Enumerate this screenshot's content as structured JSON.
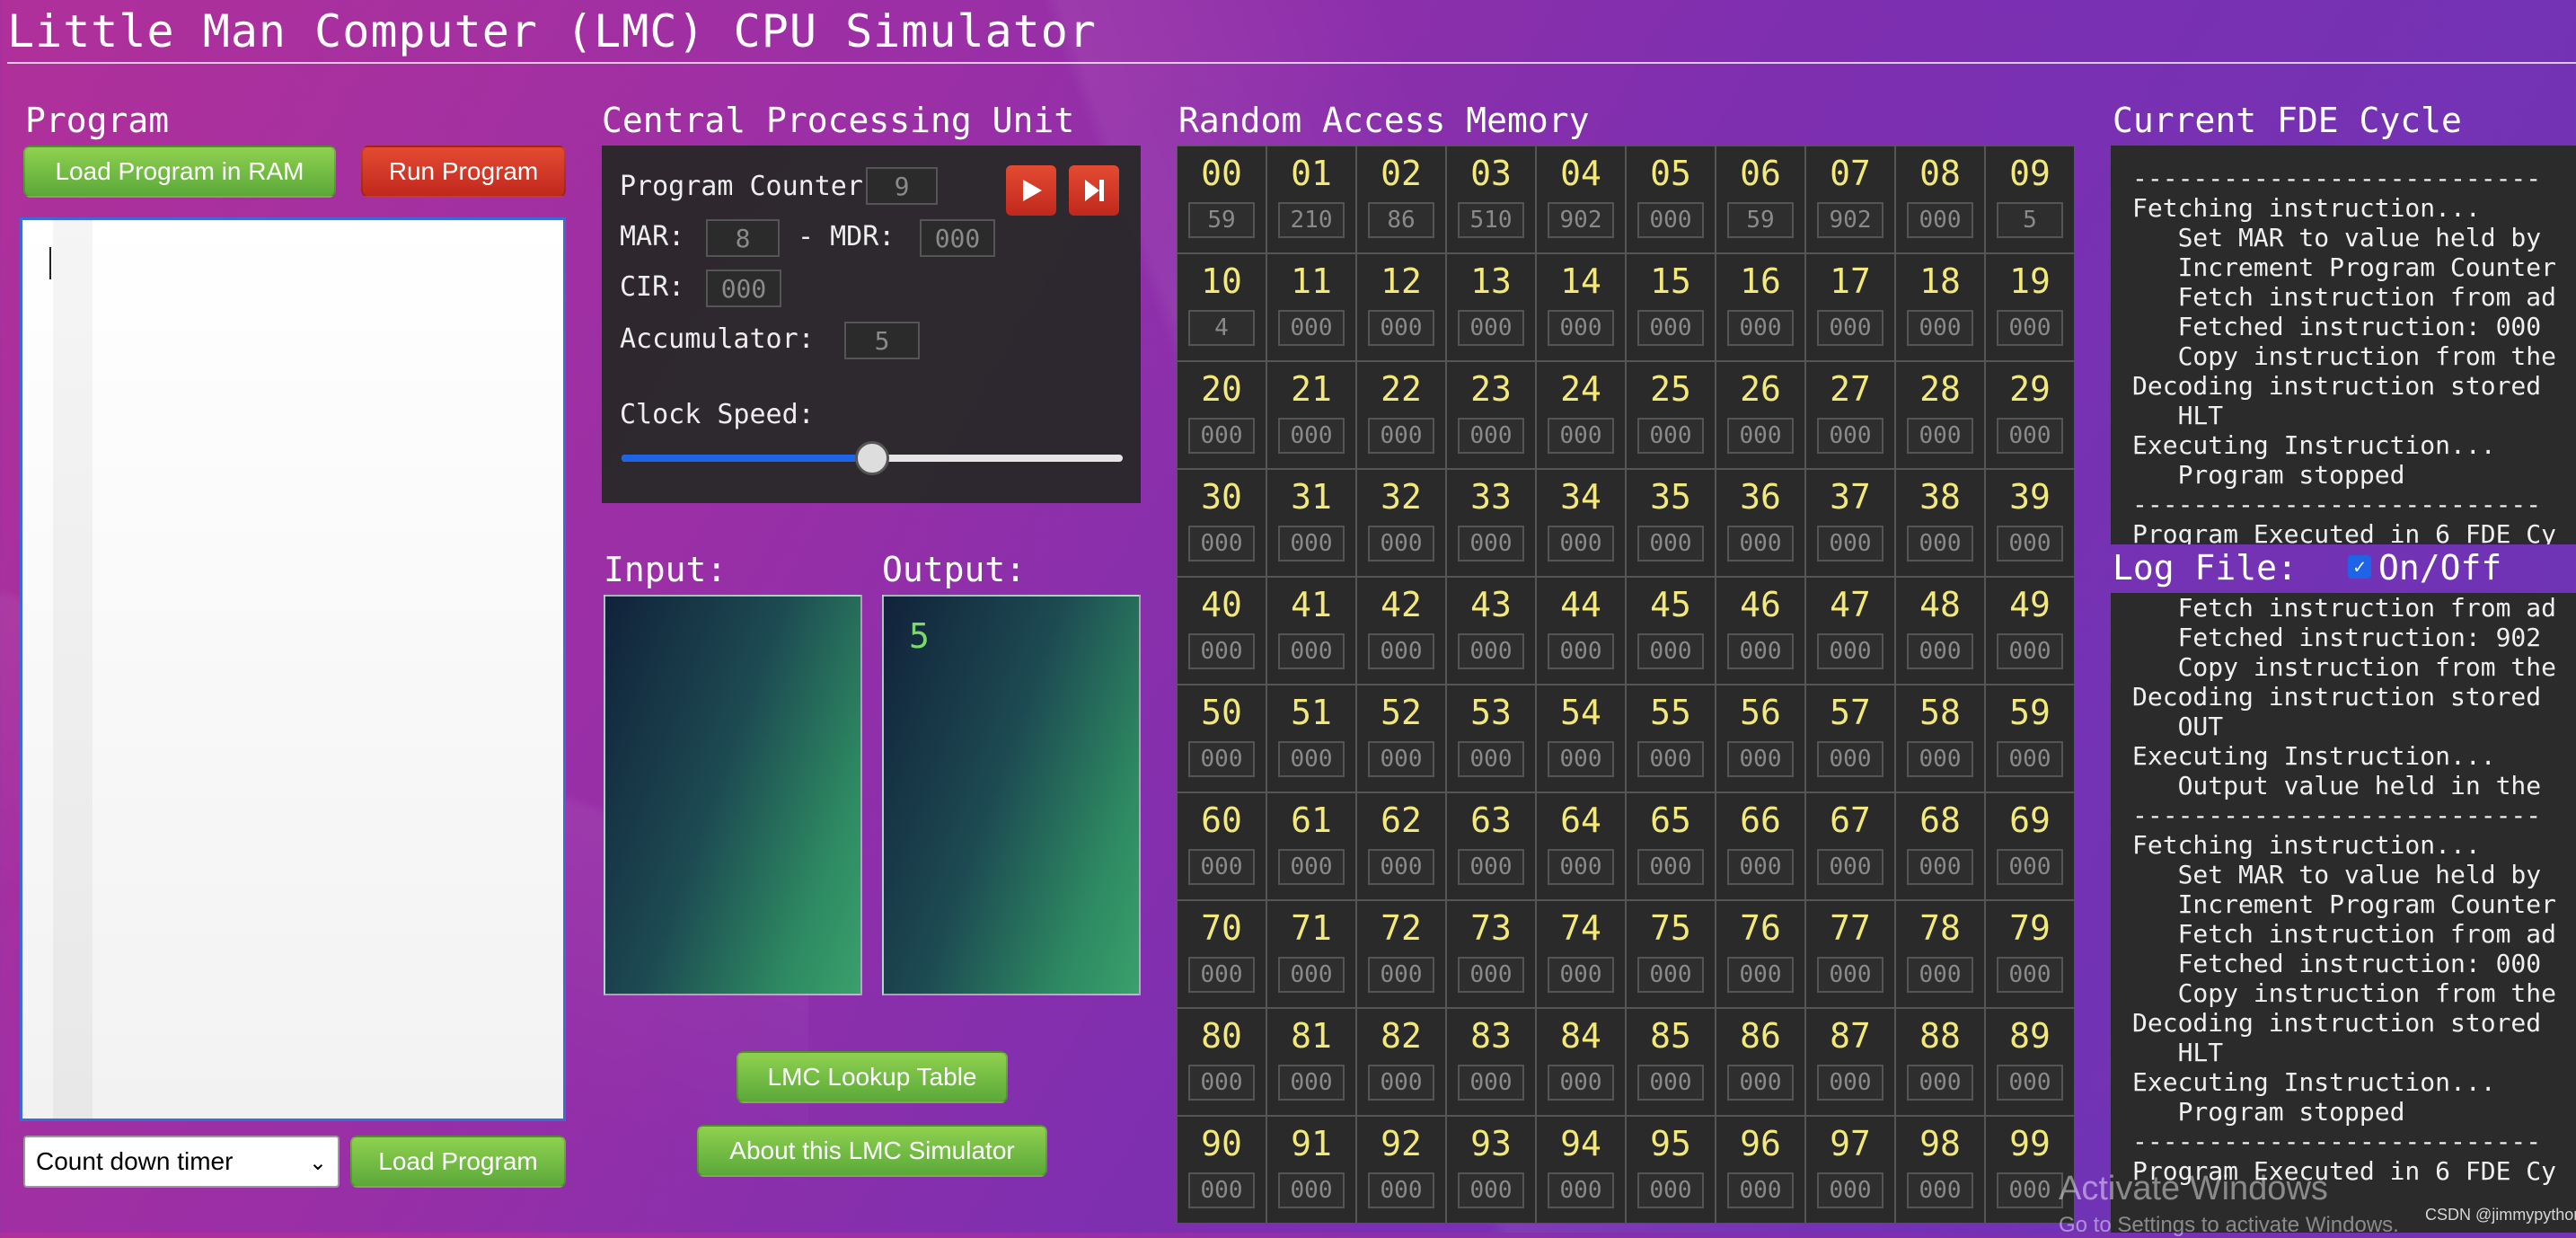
{
  "app_title": "Little Man Computer (LMC) CPU Simulator",
  "program": {
    "heading": "Program",
    "load_ram_label": "Load Program in RAM",
    "run_label": "Run Program",
    "timer_selected": "Count down timer",
    "load_program_label": "Load Program"
  },
  "cpu": {
    "heading": "Central Processing Unit",
    "pc_label": "Program Counter:",
    "pc_value": "9",
    "mar_label": "MAR:",
    "mar_value": "8",
    "mdr_label": "- MDR:",
    "mdr_value": "000",
    "cir_label": "CIR:",
    "cir_value": "000",
    "acc_label": "Accumulator:",
    "acc_value": "5",
    "clock_label": "Clock Speed:",
    "clock_level": 0.5
  },
  "io": {
    "input_label": "Input:",
    "output_label": "Output:",
    "output_value": "5"
  },
  "links": {
    "lookup_label": "LMC Lookup Table",
    "about_label": "About this LMC Simulator"
  },
  "ram": {
    "heading": "Random Access Memory",
    "cells": [
      {
        "addr": "00",
        "value": "59"
      },
      {
        "addr": "01",
        "value": "210"
      },
      {
        "addr": "02",
        "value": "86"
      },
      {
        "addr": "03",
        "value": "510"
      },
      {
        "addr": "04",
        "value": "902"
      },
      {
        "addr": "05",
        "value": "000"
      },
      {
        "addr": "06",
        "value": "59"
      },
      {
        "addr": "07",
        "value": "902"
      },
      {
        "addr": "08",
        "value": "000"
      },
      {
        "addr": "09",
        "value": "5"
      },
      {
        "addr": "10",
        "value": "4"
      },
      {
        "addr": "11",
        "value": "000"
      },
      {
        "addr": "12",
        "value": "000"
      },
      {
        "addr": "13",
        "value": "000"
      },
      {
        "addr": "14",
        "value": "000"
      },
      {
        "addr": "15",
        "value": "000"
      },
      {
        "addr": "16",
        "value": "000"
      },
      {
        "addr": "17",
        "value": "000"
      },
      {
        "addr": "18",
        "value": "000"
      },
      {
        "addr": "19",
        "value": "000"
      },
      {
        "addr": "20",
        "value": "000"
      },
      {
        "addr": "21",
        "value": "000"
      },
      {
        "addr": "22",
        "value": "000"
      },
      {
        "addr": "23",
        "value": "000"
      },
      {
        "addr": "24",
        "value": "000"
      },
      {
        "addr": "25",
        "value": "000"
      },
      {
        "addr": "26",
        "value": "000"
      },
      {
        "addr": "27",
        "value": "000"
      },
      {
        "addr": "28",
        "value": "000"
      },
      {
        "addr": "29",
        "value": "000"
      },
      {
        "addr": "30",
        "value": "000"
      },
      {
        "addr": "31",
        "value": "000"
      },
      {
        "addr": "32",
        "value": "000"
      },
      {
        "addr": "33",
        "value": "000"
      },
      {
        "addr": "34",
        "value": "000"
      },
      {
        "addr": "35",
        "value": "000"
      },
      {
        "addr": "36",
        "value": "000"
      },
      {
        "addr": "37",
        "value": "000"
      },
      {
        "addr": "38",
        "value": "000"
      },
      {
        "addr": "39",
        "value": "000"
      },
      {
        "addr": "40",
        "value": "000"
      },
      {
        "addr": "41",
        "value": "000"
      },
      {
        "addr": "42",
        "value": "000"
      },
      {
        "addr": "43",
        "value": "000"
      },
      {
        "addr": "44",
        "value": "000"
      },
      {
        "addr": "45",
        "value": "000"
      },
      {
        "addr": "46",
        "value": "000"
      },
      {
        "addr": "47",
        "value": "000"
      },
      {
        "addr": "48",
        "value": "000"
      },
      {
        "addr": "49",
        "value": "000"
      },
      {
        "addr": "50",
        "value": "000"
      },
      {
        "addr": "51",
        "value": "000"
      },
      {
        "addr": "52",
        "value": "000"
      },
      {
        "addr": "53",
        "value": "000"
      },
      {
        "addr": "54",
        "value": "000"
      },
      {
        "addr": "55",
        "value": "000"
      },
      {
        "addr": "56",
        "value": "000"
      },
      {
        "addr": "57",
        "value": "000"
      },
      {
        "addr": "58",
        "value": "000"
      },
      {
        "addr": "59",
        "value": "000"
      },
      {
        "addr": "60",
        "value": "000"
      },
      {
        "addr": "61",
        "value": "000"
      },
      {
        "addr": "62",
        "value": "000"
      },
      {
        "addr": "63",
        "value": "000"
      },
      {
        "addr": "64",
        "value": "000"
      },
      {
        "addr": "65",
        "value": "000"
      },
      {
        "addr": "66",
        "value": "000"
      },
      {
        "addr": "67",
        "value": "000"
      },
      {
        "addr": "68",
        "value": "000"
      },
      {
        "addr": "69",
        "value": "000"
      },
      {
        "addr": "70",
        "value": "000"
      },
      {
        "addr": "71",
        "value": "000"
      },
      {
        "addr": "72",
        "value": "000"
      },
      {
        "addr": "73",
        "value": "000"
      },
      {
        "addr": "74",
        "value": "000"
      },
      {
        "addr": "75",
        "value": "000"
      },
      {
        "addr": "76",
        "value": "000"
      },
      {
        "addr": "77",
        "value": "000"
      },
      {
        "addr": "78",
        "value": "000"
      },
      {
        "addr": "79",
        "value": "000"
      },
      {
        "addr": "80",
        "value": "000"
      },
      {
        "addr": "81",
        "value": "000"
      },
      {
        "addr": "82",
        "value": "000"
      },
      {
        "addr": "83",
        "value": "000"
      },
      {
        "addr": "84",
        "value": "000"
      },
      {
        "addr": "85",
        "value": "000"
      },
      {
        "addr": "86",
        "value": "000"
      },
      {
        "addr": "87",
        "value": "000"
      },
      {
        "addr": "88",
        "value": "000"
      },
      {
        "addr": "89",
        "value": "000"
      },
      {
        "addr": "90",
        "value": "000"
      },
      {
        "addr": "91",
        "value": "000"
      },
      {
        "addr": "92",
        "value": "000"
      },
      {
        "addr": "93",
        "value": "000"
      },
      {
        "addr": "94",
        "value": "000"
      },
      {
        "addr": "95",
        "value": "000"
      },
      {
        "addr": "96",
        "value": "000"
      },
      {
        "addr": "97",
        "value": "000"
      },
      {
        "addr": "98",
        "value": "000"
      },
      {
        "addr": "99",
        "value": "000"
      }
    ]
  },
  "fde": {
    "heading": "Current FDE Cycle",
    "lines": [
      "---------------------------",
      "Fetching instruction...",
      "   Set MAR to value held by",
      "   Increment Program Counter",
      "   Fetch instruction from ad",
      "   Fetched instruction: 000",
      "   Copy instruction from the",
      "Decoding instruction stored",
      "   HLT",
      "Executing Instruction...",
      "   Program stopped",
      "---------------------------",
      "Program Executed in 6 FDE Cy"
    ]
  },
  "log": {
    "heading": "Log File:",
    "toggle_label": "On/Off",
    "toggle_checked": true,
    "lines": [
      "   Fetch instruction from ad",
      "   Fetched instruction: 902",
      "   Copy instruction from the",
      "Decoding instruction stored",
      "   OUT",
      "Executing Instruction...",
      "   Output value held in the",
      "---------------------------",
      "Fetching instruction...",
      "   Set MAR to value held by",
      "   Increment Program Counter",
      "   Fetch instruction from ad",
      "   Fetched instruction: 000",
      "   Copy instruction from the",
      "Decoding instruction stored",
      "   HLT",
      "Executing Instruction...",
      "   Program stopped",
      "---------------------------",
      "Program Executed in 6 FDE Cy"
    ]
  },
  "overlay": {
    "activate_title": "Activate Windows",
    "activate_sub": "Go to Settings to activate Windows.",
    "csdn": "CSDN @jimmypython"
  },
  "colors": {
    "green_button": "#5ba83a",
    "red_button": "#c0281d",
    "address_yellow": "#f2e97a",
    "output_green": "#7bd86a",
    "slider_blue": "#1e64e6"
  }
}
